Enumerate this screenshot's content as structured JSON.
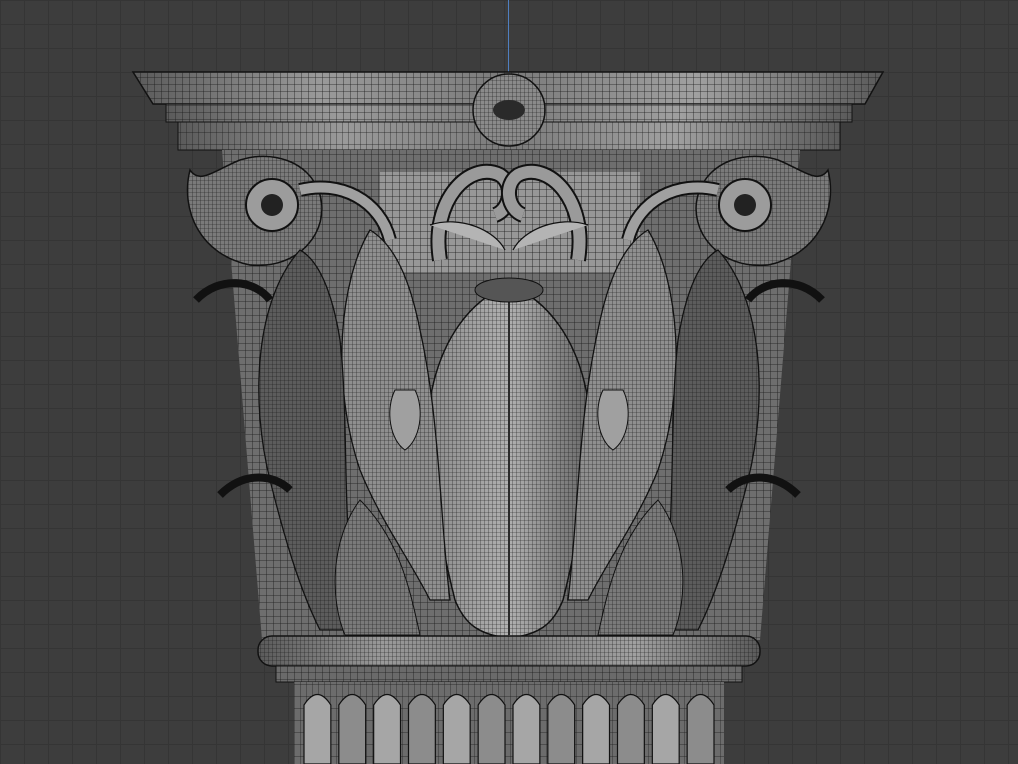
{
  "viewport": {
    "shading": "wireframe",
    "subject": "corinthian-capital",
    "colors": {
      "background": "#3d3d3d",
      "grid": "#353535",
      "axis": "#4f7fc0",
      "mesh_light": "#9a9a9a",
      "mesh_mid": "#6e6e6e",
      "mesh_dark": "#1e1e1e",
      "wire": "#141414"
    }
  }
}
